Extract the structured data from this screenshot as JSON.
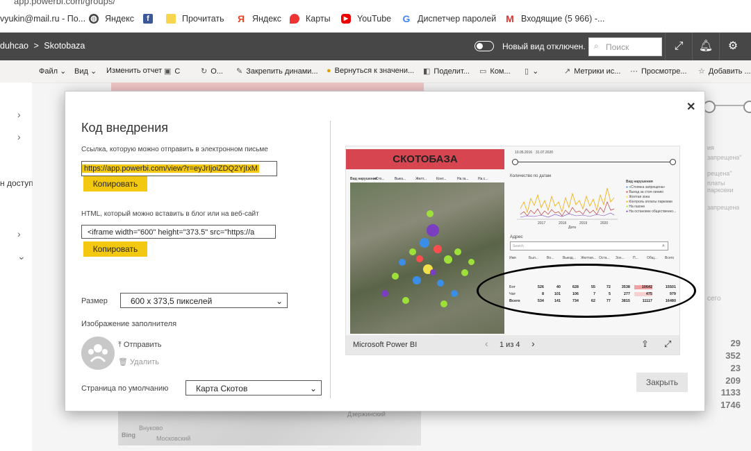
{
  "browser": {
    "url_fragment": "app.powerbi.com/groups/",
    "bookmarks": [
      {
        "label": "vyukin@mail.ru - По...",
        "icon": "mail-icon"
      },
      {
        "label": "Яндекс",
        "icon": "globe-icon"
      },
      {
        "label": "",
        "icon": "facebook-icon"
      },
      {
        "label": "Прочитать",
        "icon": "bookmark-icon"
      },
      {
        "label": "Яндекс",
        "icon": "yandex-icon"
      },
      {
        "label": "Карты",
        "icon": "map-pin-icon"
      },
      {
        "label": "YouTube",
        "icon": "youtube-icon"
      },
      {
        "label": "Диспетчер паролей",
        "icon": "google-icon"
      },
      {
        "label": "Входящие (5 966) -...",
        "icon": "gmail-icon"
      }
    ]
  },
  "header": {
    "breadcrumb_workspace": "duhcao",
    "breadcrumb_report": "Skotobaza",
    "toggle_label": "Новый вид отключен.",
    "search_placeholder": "Поиск"
  },
  "toolbar": {
    "items": [
      "Файл",
      "Вид",
      "Изменить отчет",
      "С",
      "О...",
      "Закрепить динами...",
      "Вернуться к значени...",
      "Поделит...",
      "Ком...",
      "",
      "Метрики ис...",
      "Просмотре...",
      "Добавить ..."
    ]
  },
  "sidebar": {
    "label": "н доступ"
  },
  "background": {
    "numbers": [
      "29",
      "352",
      "23",
      "209",
      "1133",
      "1746"
    ],
    "right_texts": [
      "ия",
      "запрещена\"",
      "рещена\"",
      "платы парковки",
      "запрещена",
      "сего"
    ],
    "map_labels": [
      "Bing",
      "Внуково",
      "Московский",
      "Дзержинский"
    ]
  },
  "dialog": {
    "title": "Код внедрения",
    "email_label": "Ссылка, которую можно отправить в электронном письме",
    "email_link": "https://app.powerbi.com/view?r=eyJrIjoiZDQ2YjIxM",
    "copy_label": "Копировать",
    "html_label": "HTML, который можно вставить в блог или на веб-сайт",
    "html_code": "<iframe width=\"600\" height=\"373.5\" src=\"https://a",
    "size_label": "Размер",
    "size_value": "600 x 373,5 пикселей",
    "placeholder_label": "Изображение заполнителя",
    "upload_label": "Отправить",
    "delete_label": "Удалить",
    "default_page_label": "Страница по умолчанию",
    "default_page_value": "Карта Скотов",
    "close_label": "Закрыть"
  },
  "preview": {
    "banner": "СКОТОБАЗА",
    "legend_label": "Вид нарушения",
    "legend_items": [
      "«Сто...",
      "Выез...",
      "Желт...",
      "Конт...",
      "На га...",
      "На с..."
    ],
    "date_from": "10.05.2016",
    "date_to": "31.07.2020",
    "chart_title": "Количество по датам",
    "chart_xlabel": "Дата",
    "chart_years": [
      "2017",
      "2018",
      "2019",
      "2020"
    ],
    "chart_legend_title": "Вид нарушения",
    "chart_legend": [
      "«Стоянка запрещена»",
      "Выезд за стоп-линию",
      "Желтая зона",
      "Контроль оплаты парковки",
      "На газоне",
      "На остановке общественно..."
    ],
    "address_label": "Адрес",
    "search_placeholder": "Search",
    "table": {
      "headers": [
        "Имя",
        "Был...",
        "Во...",
        "Выезд...",
        "Желтая...",
        "Оста...",
        "Зон...",
        "П...",
        "Общ...",
        "Всего"
      ],
      "rows": [
        {
          "name": "Бот",
          "values": [
            "526",
            "40",
            "628",
            "55",
            "72",
            "3538",
            "10642",
            "15501"
          ]
        },
        {
          "name": "Чат",
          "values": [
            "8",
            "101",
            "106",
            "7",
            "5",
            "277",
            "475",
            "979"
          ]
        },
        {
          "name": "Всего",
          "values": [
            "534",
            "141",
            "734",
            "62",
            "77",
            "3815",
            "11117",
            "16480"
          ]
        }
      ]
    },
    "footer_brand": "Microsoft Power BI",
    "pager": "1 из 4"
  }
}
